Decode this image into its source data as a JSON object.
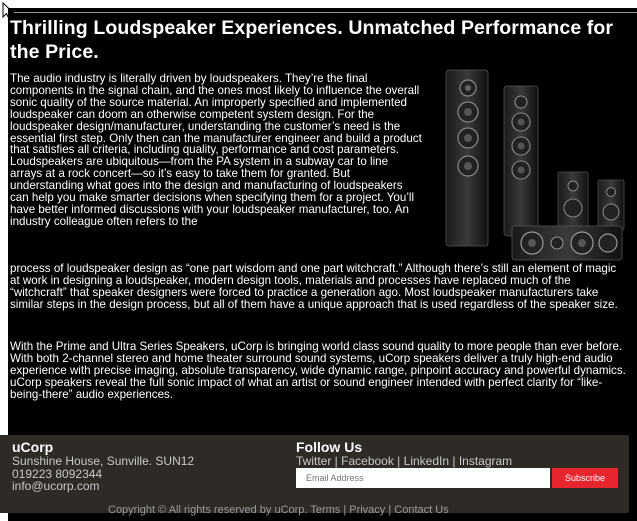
{
  "heading": "Thrilling Loudspeaker Experiences. Unmatched Performance for the Price.",
  "intro_paragraph_part1": "The audio industry is literally driven by loudspeakers. They’re the final components in the signal chain, and the ones most likely to influence the overall sonic quality of the source material. An improperly specified and implemented loudspeaker can doom an otherwise competent system design. For the loudspeaker design/manufacturer, understanding the customer’s need is the essential first step. Only then can the manufacturer engineer and build a product that satisfies all criteria, including quality, performance and cost parameters. Loudspeakers are ubiquitous—from the PA system in a subway car to line arrays at a rock concert—so it’s easy to take them for granted. But understanding what goes into the design and manufacturing of loudspeakers can help you make smarter decisions when specifying them for a project. You’ll have better informed discussions with your loudspeaker manufacturer, too. An industry colleague often refers to the",
  "intro_paragraph_part2": "process of loudspeaker design as “one part wisdom and one part witchcraft.” Although there’s still an element of magic at work in designing a loudspeaker, modern design tools, materials and processes have replaced much of the “witchcraft” that speaker designers were forced to practice a generation ago. Most loudspeaker manufacturers take similar steps in the design process, but all of them have a unique approach that is used regardless of the speaker size.",
  "second_paragraph": "With the Prime and Ultra Series Speakers, uCorp is bringing world class sound quality to more people than ever before. With both 2-channel stereo and home theater surround sound systems, uCorp speakers deliver a truly high-end audio experience with precise imaging, absolute transparency, wide dynamic range, pinpoint accuracy and powerful dynamics. uCorp speakers reveal the full sonic impact of what an artist or sound engineer intended with perfect clarity for “like-being-there” audio experiences.",
  "image_icon": "speakers-product-photo",
  "footer": {
    "brand": "uCorp",
    "address": "Sunshine House, Sunville. SUN12",
    "phone": "019223 8092344",
    "email": "info@ucorp.com",
    "follow_title": "Follow Us",
    "social_links": [
      "Twitter",
      "Facebook",
      "LinkedIn",
      "Instagram"
    ],
    "email_placeholder": "Email Address",
    "subscribe_label": "Subscribe",
    "copyright_partial": "Copyright © All rights reserved by uCorp. Terms | Privacy | Contact Us"
  },
  "colors": {
    "page_background": "#000000",
    "footer_background": "#2e2a26",
    "subscribe_button": "#e5262e"
  }
}
